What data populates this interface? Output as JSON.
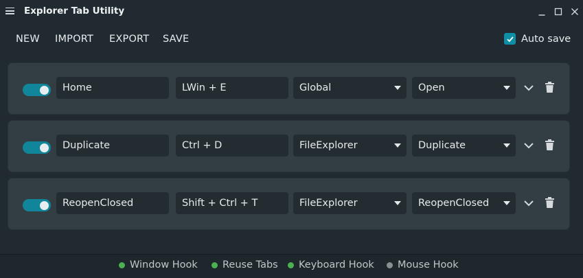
{
  "window": {
    "title": "Explorer Tab Utility"
  },
  "toolbar": {
    "new_label": "NEW",
    "import_label": "IMPORT",
    "export_label": "EXPORT",
    "save_label": "SAVE",
    "autosave_label": "Auto save",
    "autosave_checked": true
  },
  "hotkeys": [
    {
      "enabled": true,
      "name": "Home",
      "keys": "LWin + E",
      "scope": "Global",
      "action": "Open"
    },
    {
      "enabled": true,
      "name": "Duplicate",
      "keys": "Ctrl + D",
      "scope": "FileExplorer",
      "action": "Duplicate"
    },
    {
      "enabled": true,
      "name": "ReopenClosed",
      "keys": "Shift + Ctrl + T",
      "scope": "FileExplorer",
      "action": "ReopenClosed"
    }
  ],
  "status": [
    {
      "label": "Window Hook",
      "active": true
    },
    {
      "label": "Reuse Tabs",
      "active": true
    },
    {
      "label": "Keyboard Hook",
      "active": true
    },
    {
      "label": "Mouse Hook",
      "active": false
    }
  ],
  "colors": {
    "background": "#202a30",
    "card": "#323d44",
    "accent": "#11869a",
    "status_active": "#4caf50",
    "status_inactive": "#8a8f92"
  }
}
